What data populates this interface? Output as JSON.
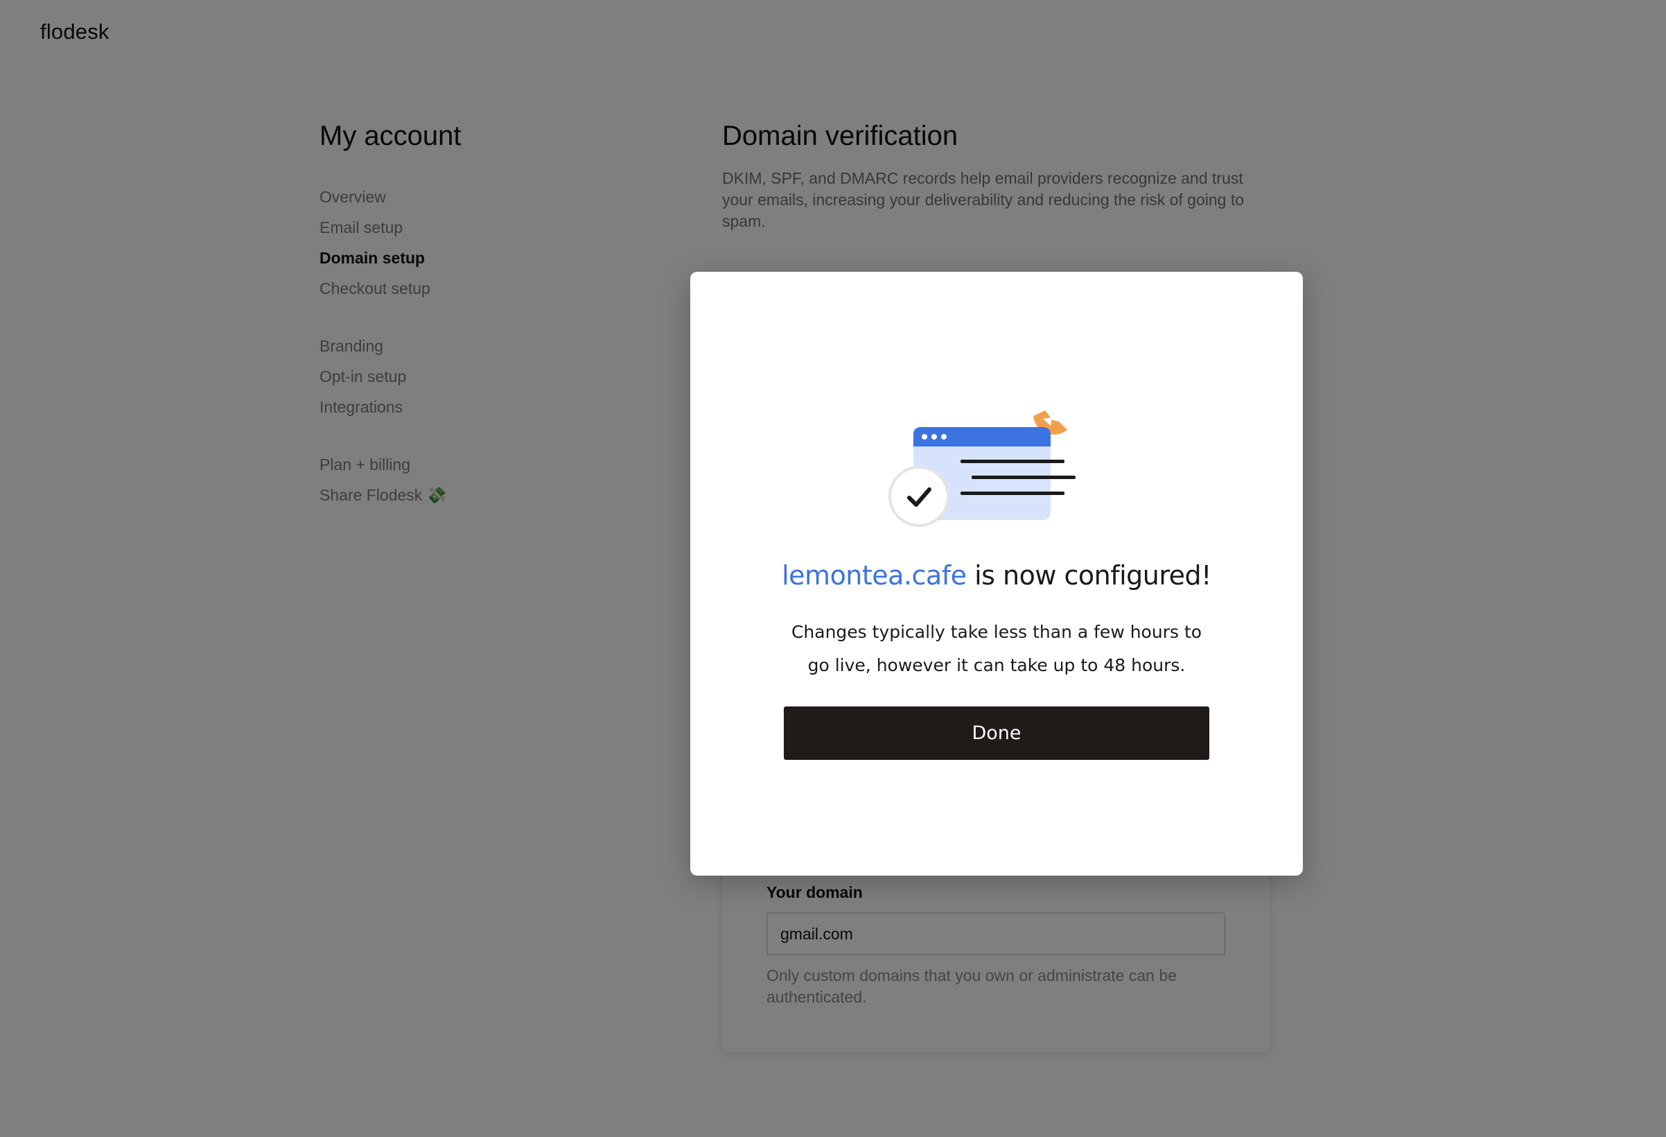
{
  "app": {
    "logo": "flodesk"
  },
  "sidebar": {
    "title": "My account",
    "groups": [
      [
        {
          "label": "Overview"
        },
        {
          "label": "Email setup"
        },
        {
          "label": "Domain setup",
          "active": true
        },
        {
          "label": "Checkout setup"
        }
      ],
      [
        {
          "label": "Branding"
        },
        {
          "label": "Opt-in setup"
        },
        {
          "label": "Integrations"
        }
      ],
      [
        {
          "label": "Plan + billing"
        },
        {
          "label": "Share Flodesk 💸"
        }
      ]
    ]
  },
  "main": {
    "title": "Domain verification",
    "description": "DKIM, SPF, and DMARC records help email providers recognize and trust your emails, increasing your deliverability and reducing the risk of going to spam.",
    "domain_card": {
      "label": "Your domain",
      "value": "gmail.com",
      "hint": "Only custom domains that you own or administrate can be authenticated."
    }
  },
  "modal": {
    "domain": "lemontea.cafe",
    "title_suffix": " is now configured!",
    "body": "Changes typically take less than a few hours to go live, however it can take up to 48 hours.",
    "done_label": "Done",
    "icons": [
      "browser-window-icon",
      "check-circle-icon",
      "lemon-slice-icon"
    ]
  },
  "colors": {
    "accent_blue": "#3b73e0",
    "button_dark": "#201a18",
    "overlay": "rgba(0,0,0,0.5)",
    "lemon_orange": "#f0a04b",
    "browser_light": "#d6e3fb"
  }
}
